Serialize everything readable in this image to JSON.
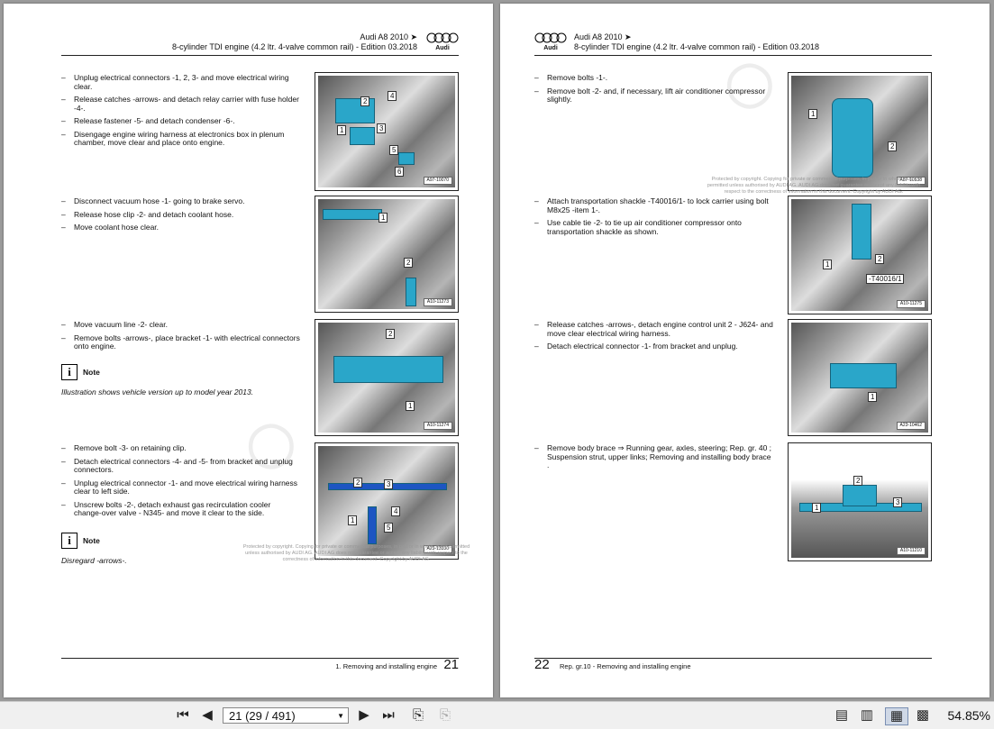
{
  "header": {
    "model": "Audi A8 2010 ➤",
    "engine": "8-cylinder TDI engine (4.2 ltr. 4-valve common rail) - Edition 03.2018",
    "brand": "Audi"
  },
  "left_page": {
    "page_number": "21",
    "footer": "1. Removing and installing engine",
    "steps": [
      [
        "Unplug electrical connectors -1, 2, 3- and move electrical wiring clear.",
        "Release catches -arrows- and detach relay carrier with fuse holder -4-.",
        "Release fastener -5- and detach condenser -6-.",
        "Disengage engine wiring harness at electronics box in plenum chamber, move clear and place onto engine."
      ],
      [
        "Disconnect vacuum hose -1- going to brake servo.",
        "Release hose clip -2- and detach coolant hose.",
        "Move coolant hose clear."
      ],
      [
        "Move vacuum line -2- clear.",
        "Remove bolts -arrows-, place bracket -1- with electrical connectors onto engine."
      ],
      [
        "Remove bolt -3- on retaining clip.",
        "Detach electrical connectors -4- and -5- from bracket and unplug connectors.",
        "Unplug electrical connector -1- and move electrical wiring harness clear to left side.",
        "Unscrew bolts -2-, detach exhaust gas recirculation cooler change-over valve - N345- and move it clear to the side."
      ]
    ],
    "notes": [
      {
        "label": "Note",
        "text": "Illustration shows vehicle version up to model year 2013."
      },
      {
        "label": "Note",
        "text": "Disregard -arrows-."
      }
    ],
    "figure_codes": [
      "A97-10070",
      "A10-11273",
      "A10-11274",
      "A23-13330"
    ]
  },
  "right_page": {
    "page_number": "22",
    "footer": "Rep. gr.10 - Removing and installing engine",
    "steps": [
      [
        "Remove bolts -1-.",
        "Remove bolt -2- and, if necessary, lift air conditioner compressor slightly."
      ],
      [
        "Attach transportation shackle -T40016/1- to lock carrier using bolt M8x25 -item 1-.",
        "Use cable tie -2- to tie up air conditioner compressor onto transportation shackle as shown."
      ],
      [
        "Release catches -arrows-, detach engine control unit 2 - J624- and move clear electrical wiring harness.",
        "Detach electrical connector -1- from bracket and unplug."
      ],
      [
        "Remove body brace ⇒ Running gear, axles, steering; Rep. gr. 40 ; Suspension strut, upper links; Removing and installing body brace ."
      ]
    ],
    "figure_codes": [
      "A87-10538",
      "A10-11275",
      "A23-10462",
      "A10-11210"
    ],
    "tool_label": "-T40016/1"
  },
  "copyright": "Protected by copyright. Copying for private or commercial purposes, in part or in whole, is not permitted unless authorised by AUDI AG. AUDI AG does not guarantee or accept any liability with respect to the correctness of information in this document. Copyright by AUDI AG.",
  "toolbar": {
    "page_display": "21 (29 / 491)",
    "zoom": "54.85%"
  },
  "colors": {
    "highlight": "#2aa6c9",
    "viewer_bg": "#9b9b9b"
  }
}
